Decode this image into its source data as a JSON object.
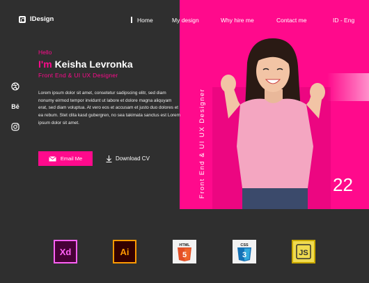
{
  "brand": {
    "name": "IDesign"
  },
  "nav": {
    "items": [
      {
        "label": "Home"
      },
      {
        "label": "My design"
      },
      {
        "label": "Why hire me"
      },
      {
        "label": "Contact me"
      },
      {
        "label": "ID - Eng"
      }
    ]
  },
  "social": [
    {
      "icon": "dribbble-icon"
    },
    {
      "icon": "behance-icon"
    },
    {
      "icon": "instagram-icon"
    }
  ],
  "hero": {
    "hello": "Hello",
    "im": "I'm",
    "name": "Keisha Levronka",
    "role": "Front End & UI UX Designer",
    "bio": "Lorem ipsum dolor sit amet, consetetur sadipscing elitr, sed diam nonumy eirmod tempor invidunt ut labore et dolore magna aliquyam erat, sed diam voluptua. At vero eos et accusam et justo duo dolores et ea rebum. Stet clita kasd gubergren, no sea takimata sanctus est Lorem ipsum dolor sit amet.",
    "email_label": "Email Me",
    "cv_label": "Download CV",
    "vertical_label": "Front End & UI UX Designer",
    "years": "22"
  },
  "skills": [
    {
      "label": "Xd",
      "icon": "adobe-xd-icon"
    },
    {
      "label": "Ai",
      "icon": "adobe-illustrator-icon"
    },
    {
      "label": "HTML",
      "icon": "html5-icon"
    },
    {
      "label": "CSS",
      "icon": "css3-icon"
    },
    {
      "label": "JS",
      "icon": "javascript-icon"
    }
  ],
  "colors": {
    "background": "#2f2f2f",
    "accent": "#ff0a8c"
  }
}
